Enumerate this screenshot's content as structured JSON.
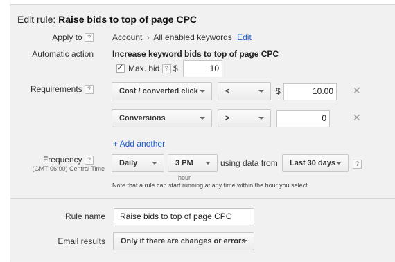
{
  "header": {
    "prefix": "Edit rule:",
    "rule_title": "Raise bids to top of page CPC"
  },
  "apply_to": {
    "label": "Apply to",
    "help": "?",
    "scope": "Account",
    "separator": "›",
    "target": "All enabled keywords",
    "edit_link": "Edit"
  },
  "automatic_action": {
    "label": "Automatic action",
    "description": "Increase keyword bids to top of page CPC",
    "max_bid_label": "Max. bid",
    "max_bid_checked": true,
    "check_glyph": "✓",
    "help": "?",
    "currency": "$",
    "max_bid_value": "10"
  },
  "requirements": {
    "label": "Requirements",
    "help": "?",
    "rows": [
      {
        "metric": "Cost / converted click",
        "operator": "<",
        "currency": "$",
        "value": "10.00",
        "remove": "✕"
      },
      {
        "metric": "Conversions",
        "operator": ">",
        "currency": "",
        "value": "0",
        "remove": "✕"
      }
    ],
    "add_another": "+ Add another"
  },
  "frequency": {
    "label": "Frequency",
    "help": "?",
    "timezone": "(GMT-06:00) Central Time",
    "period": "Daily",
    "time": "3 PM",
    "time_sub": "hour",
    "using_data_text": "using data from",
    "date_range": "Last 30 days",
    "date_help": "?",
    "note": "Note that a rule can start running at any time within the hour you select."
  },
  "rule_name": {
    "label": "Rule name",
    "value": "Raise bids to top of page CPC"
  },
  "email_results": {
    "label": "Email results",
    "value": "Only if there are changes or errors"
  }
}
